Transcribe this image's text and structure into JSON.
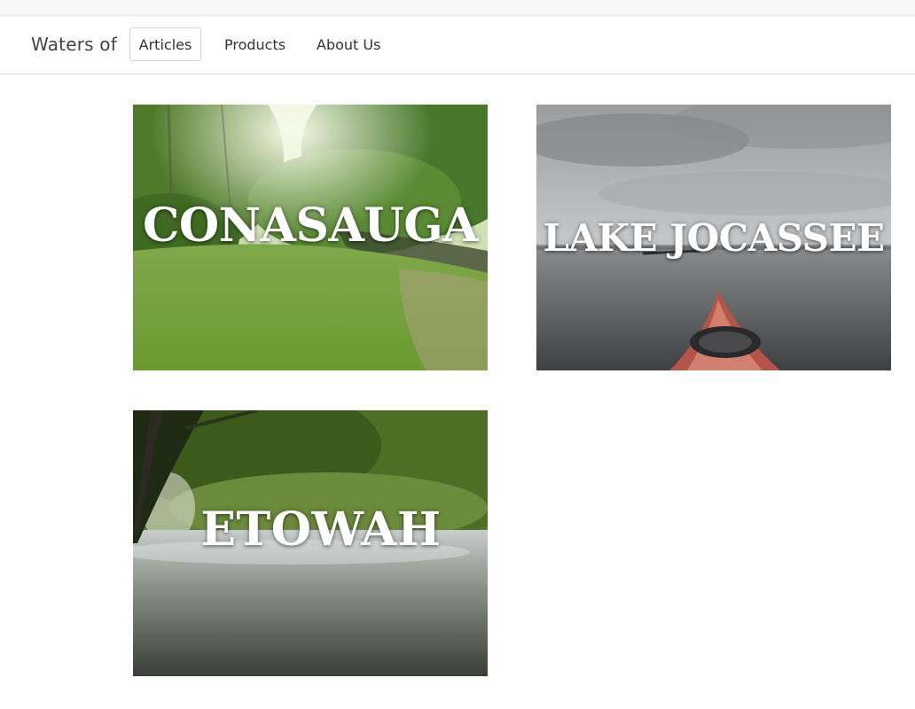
{
  "navbar": {
    "brand": "Waters of",
    "items": [
      {
        "label": "Articles",
        "active": true
      },
      {
        "label": "Products",
        "active": false
      },
      {
        "label": "About Us",
        "active": false
      }
    ]
  },
  "cards": [
    {
      "title": "CONASAUGA",
      "image": "river-forest-grass-photo"
    },
    {
      "title": "LAKE JOCASSEE",
      "image": "lake-kayak-photo"
    },
    {
      "title": "ETOWAH",
      "image": "river-trees-photo"
    }
  ],
  "colors": {
    "card_title": "#ffffff",
    "nav_border": "#d4d4d4"
  }
}
